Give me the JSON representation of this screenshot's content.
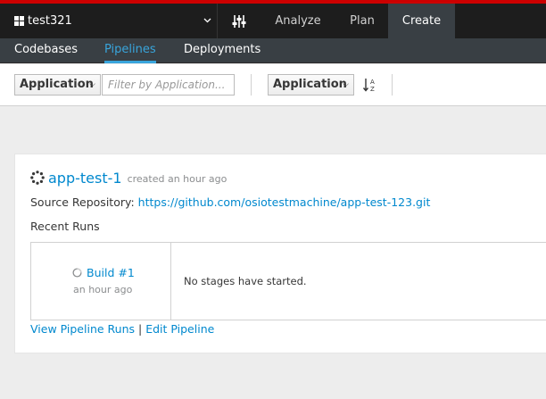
{
  "colors": {
    "accent": "#0088ce",
    "brand_bar": "#cc0000",
    "topbar": "#1d1d1d",
    "subnav": "#393f44",
    "active_tab": "#39a5dc"
  },
  "space": {
    "name": "test321",
    "icon": "grid-icon",
    "caret_icon": "chevron-down-icon"
  },
  "topnav": {
    "tune_icon": "sliders-icon",
    "items": [
      {
        "label": "Analyze",
        "active": false
      },
      {
        "label": "Plan",
        "active": false
      },
      {
        "label": "Create",
        "active": true
      }
    ]
  },
  "subnav": {
    "tabs": [
      {
        "label": "Codebases",
        "active": false
      },
      {
        "label": "Pipelines",
        "active": true
      },
      {
        "label": "Deployments",
        "active": false
      }
    ]
  },
  "toolbar": {
    "filter_field": "Application",
    "filter_placeholder": "Filter by Application...",
    "sort_field": "Application",
    "sort_icon": "sort-alpha-icon"
  },
  "pipeline": {
    "name": "app-test-1",
    "status_icon": "spinner-icon",
    "created": "created an hour ago",
    "source_label": "Source Repository:",
    "source_url": "https://github.com/osiotestmachine/app-test-123.git",
    "recent_runs_label": "Recent Runs",
    "runs": [
      {
        "label": "Build #1",
        "time": "an hour ago",
        "status_icon": "pending-icon",
        "stages": "No stages have started."
      }
    ],
    "view_runs_label": "View Pipeline Runs",
    "separator": "|",
    "edit_label": "Edit Pipeline"
  }
}
